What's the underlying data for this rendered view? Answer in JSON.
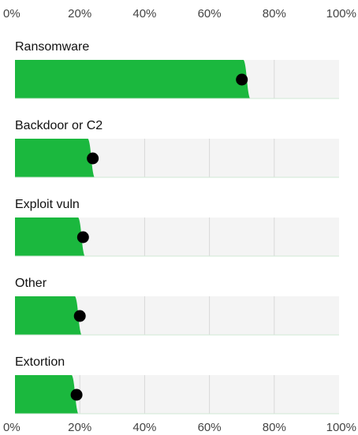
{
  "chart_data": {
    "type": "bar",
    "orientation": "horizontal",
    "title": "",
    "xlabel": "",
    "ylabel": "",
    "xlim": [
      0,
      100
    ],
    "ticks": [
      "0%",
      "20%",
      "40%",
      "60%",
      "80%",
      "100%"
    ],
    "tick_values": [
      0,
      20,
      40,
      60,
      80,
      100
    ],
    "categories": [
      "Ransomware",
      "Backdoor or C2",
      "Exploit vuln",
      "Other",
      "Extortion"
    ],
    "values": [
      72,
      24,
      21,
      20,
      19
    ],
    "markers": [
      70,
      24,
      21,
      20,
      19
    ],
    "grid": true,
    "legend": "none",
    "colors": {
      "bar": "#1bb83e",
      "track": "#f4f4f4",
      "gridline": "#d8d8d8",
      "marker": "#000000"
    }
  }
}
